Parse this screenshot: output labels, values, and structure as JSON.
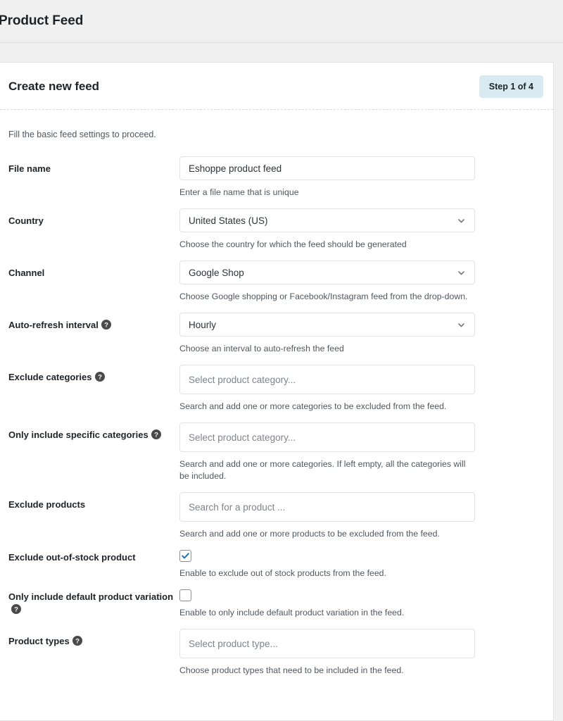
{
  "app": {
    "title": "Product Feed"
  },
  "card": {
    "title": "Create new feed",
    "step_badge": "Step 1 of 4",
    "intro": "Fill the basic feed settings to proceed."
  },
  "colors": {
    "page_bg": "#f0f0f1",
    "card_bg": "#ffffff",
    "badge_bg": "#d9eaf2",
    "text": "#1d2327",
    "muted_text": "#50575e",
    "checkbox_check": "#2271b1",
    "border": "#e2e4e7"
  },
  "fields": [
    {
      "id": "file-name",
      "label": "File name",
      "has_help": false,
      "control": "text",
      "value": "Eshoppe product feed",
      "placeholder": "",
      "hint": "Enter a file name that is unique"
    },
    {
      "id": "country",
      "label": "Country",
      "has_help": false,
      "control": "select",
      "value": "United States (US)",
      "hint": "Choose the country for which the feed should be generated"
    },
    {
      "id": "channel",
      "label": "Channel",
      "has_help": false,
      "control": "select",
      "value": "Google Shop",
      "hint": "Choose Google shopping or Facebook/Instagram feed from the drop-down."
    },
    {
      "id": "auto-refresh-interval",
      "label": "Auto-refresh interval",
      "has_help": true,
      "control": "select",
      "value": "Hourly",
      "hint": "Choose an interval to auto-refresh the feed"
    },
    {
      "id": "exclude-categories",
      "label": "Exclude categories",
      "has_help": true,
      "control": "multiselect",
      "value": "",
      "placeholder": "Select product category...",
      "hint": "Search and add one or more categories to be excluded from the feed."
    },
    {
      "id": "only-include-specific-categories",
      "label": "Only include specific categories",
      "has_help": true,
      "control": "multiselect",
      "value": "",
      "placeholder": "Select product category...",
      "hint": "Search and add one or more categories. If left empty, all the categories will be included."
    },
    {
      "id": "exclude-products",
      "label": "Exclude products",
      "has_help": false,
      "control": "multiselect",
      "value": "",
      "placeholder": "Search for a product ...",
      "hint": "Search and add one or more products to be excluded from the feed."
    },
    {
      "id": "exclude-out-of-stock-product",
      "label": "Exclude out-of-stock product",
      "has_help": false,
      "control": "checkbox",
      "checked": true,
      "hint": "Enable to exclude out of stock products from the feed."
    },
    {
      "id": "only-include-default-product-variation",
      "label": "Only include default product variation",
      "has_help": true,
      "control": "checkbox",
      "checked": false,
      "hint": "Enable to only include default product variation in the feed."
    },
    {
      "id": "product-types",
      "label": "Product types",
      "has_help": true,
      "control": "multiselect",
      "value": "",
      "placeholder": "Select product type...",
      "hint": "Choose product types that need to be included in the feed."
    }
  ],
  "icons": {
    "help": "question-mark-circle-icon",
    "chevron": "chevron-down-icon",
    "check": "check-icon"
  }
}
